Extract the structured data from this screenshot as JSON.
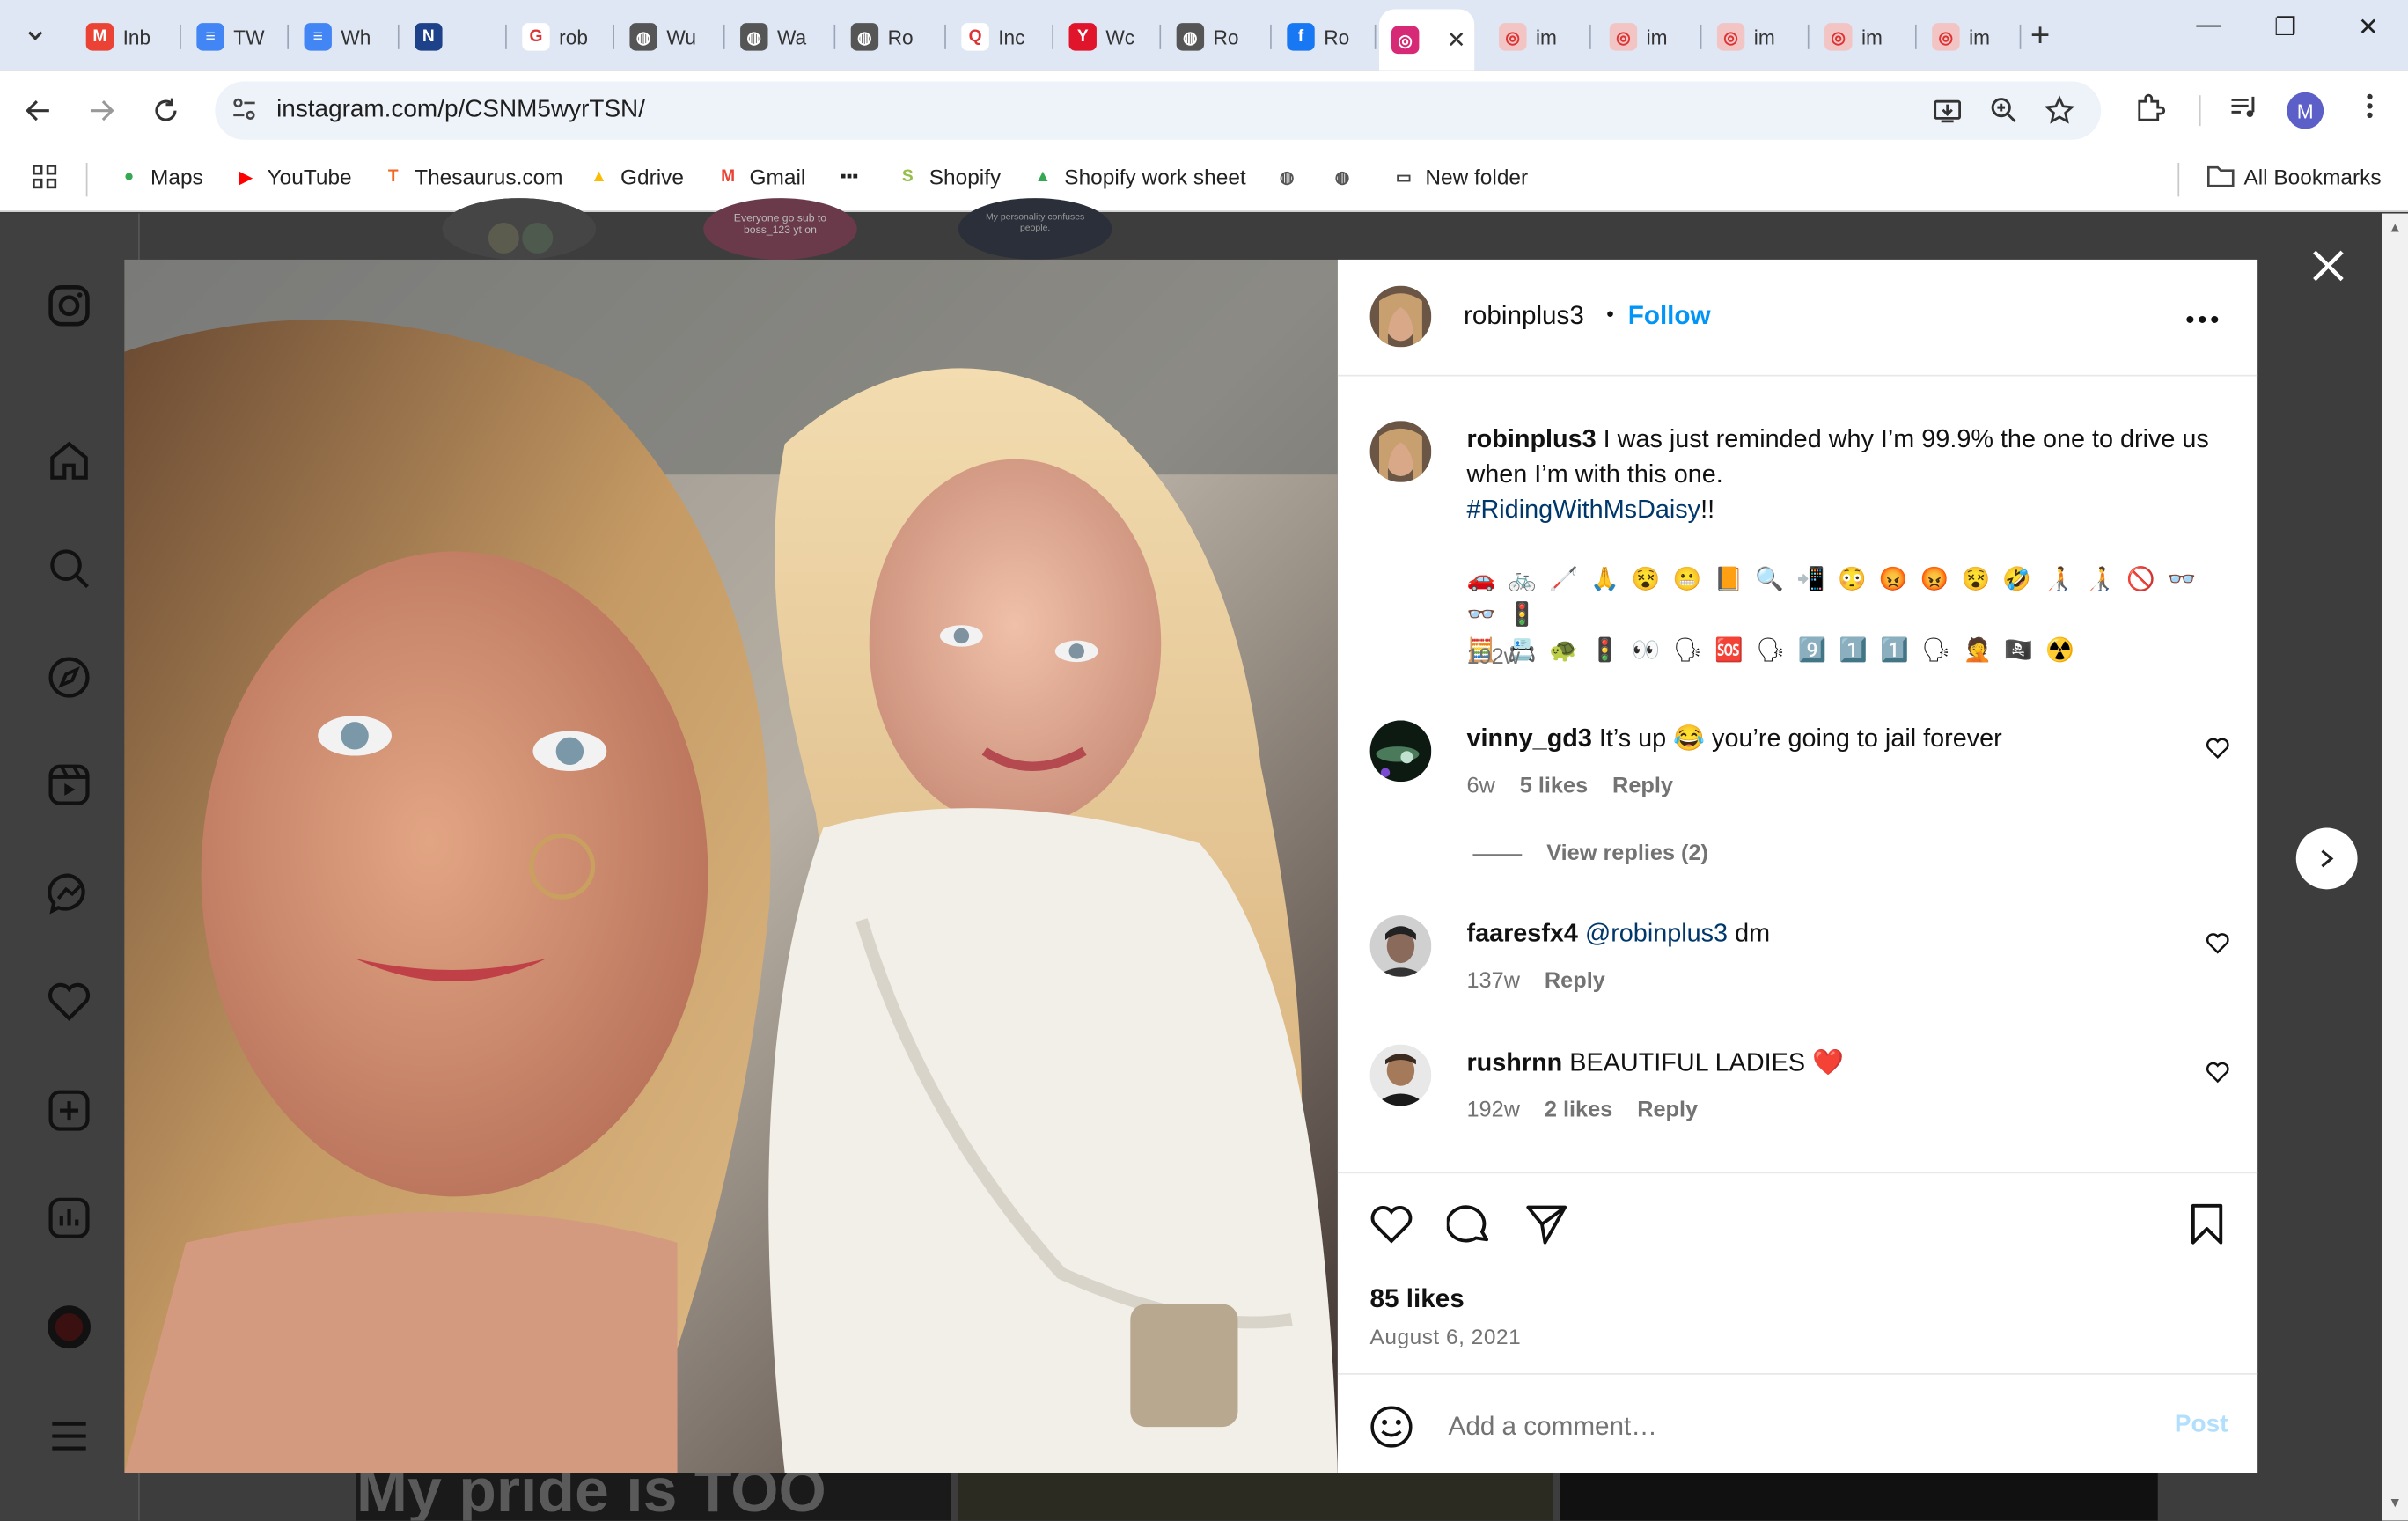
{
  "browser": {
    "tabs": [
      {
        "label": "Inb",
        "fav_color": "#ea4335",
        "fav_text": "M"
      },
      {
        "label": "TW",
        "fav_color": "#4285f4",
        "fav_text": "≡"
      },
      {
        "label": "Wh",
        "fav_color": "#4285f4",
        "fav_text": "≡"
      },
      {
        "label": "",
        "fav_color": "#1d428a",
        "fav_text": "N"
      },
      {
        "label": "rob",
        "fav_color": "#ffffff",
        "fav_text": "G"
      },
      {
        "label": "Wu",
        "fav_color": "#555555",
        "fav_text": "◍"
      },
      {
        "label": "Wa",
        "fav_color": "#555555",
        "fav_text": "◍"
      },
      {
        "label": "Ro",
        "fav_color": "#555555",
        "fav_text": "◍"
      },
      {
        "label": "Inc",
        "fav_color": "#ffffff",
        "fav_text": "Q"
      },
      {
        "label": "Wc",
        "fav_color": "#e0142b",
        "fav_text": "Y"
      },
      {
        "label": "Ro",
        "fav_color": "#555555",
        "fav_text": "◍"
      },
      {
        "label": "Ro",
        "fav_color": "#1877f2",
        "fav_text": "f"
      },
      {
        "label": "",
        "fav_color": "#d62976",
        "fav_text": "◎"
      },
      {
        "label": "im",
        "fav_color": "#f2c4c4",
        "fav_text": "◎"
      },
      {
        "label": "im",
        "fav_color": "#f2c4c4",
        "fav_text": "◎"
      },
      {
        "label": "im",
        "fav_color": "#f2c4c4",
        "fav_text": "◎"
      },
      {
        "label": "im",
        "fav_color": "#f2c4c4",
        "fav_text": "◎"
      },
      {
        "label": "im",
        "fav_color": "#f2c4c4",
        "fav_text": "◎"
      }
    ],
    "url": "instagram.com/p/CSNM5wyrTSN/",
    "profile_initial": "M",
    "bookmarks": [
      {
        "label": "Maps",
        "icon": "maps-icon",
        "color": "#34a853",
        "glyph": "●"
      },
      {
        "label": "YouTube",
        "icon": "youtube-icon",
        "color": "#ff0000",
        "glyph": "▶"
      },
      {
        "label": "Thesaurus.com",
        "icon": "thesaurus-icon",
        "color": "#f26522",
        "glyph": "T"
      },
      {
        "label": "Gdrive",
        "icon": "gdrive-icon",
        "color": "#fbbc04",
        "glyph": "▲"
      },
      {
        "label": "Gmail",
        "icon": "gmail-icon",
        "color": "#ea4335",
        "glyph": "M"
      },
      {
        "label": "",
        "icon": "bbc-icon",
        "color": "#222222",
        "glyph": "▪▪▪"
      },
      {
        "label": "Shopify",
        "icon": "shopify-icon",
        "color": "#95bf47",
        "glyph": "S"
      },
      {
        "label": "Shopify work sheet",
        "icon": "gdrive-icon",
        "color": "#34a853",
        "glyph": "▲"
      },
      {
        "label": "",
        "icon": "globe-icon",
        "color": "#555555",
        "glyph": "◍"
      },
      {
        "label": "",
        "icon": "globe-icon",
        "color": "#555555",
        "glyph": "◍"
      },
      {
        "label": "New folder",
        "icon": "folder-icon",
        "color": "#444444",
        "glyph": "▭"
      }
    ],
    "all_bookmarks": "All Bookmarks"
  },
  "background": {
    "story_text": "Everyone go sub to boss_123 yt on",
    "story_text_2": "My personality confuses people.",
    "post_text": "My pride is TOO"
  },
  "post": {
    "author": "robinplus3",
    "dot": "•",
    "follow_label": "Follow",
    "caption": {
      "user": "robinplus3",
      "text": "I was just reminded why I’m 99.9% the one to drive us when I’m with this one.",
      "hashtag": "#RidingWithMsDaisy",
      "after_hashtag": "!!",
      "emojis_line1": "🚗 🚲 🦯 🙏 😵 😬 📙 🔍 📲 😳 😡 😡 😵 🤣 🧑‍🦯 🧑‍🦯 🚫 👓 👓 🚦",
      "emojis_line2": "🧮 📇 🐢 🚦 👀 🗣 🆘 🗣 9️⃣ 1️⃣ 1️⃣ 🗣 🤦 🏴‍☠️ ☢️",
      "time": "192w"
    },
    "comments": [
      {
        "user": "vinny_gd3",
        "text": "It’s up 😂 you’re going to jail forever",
        "time": "6w",
        "likes": "5 likes",
        "reply": "Reply"
      },
      {
        "user": "faaresfx4",
        "mention": "@robinplus3",
        "text": "dm",
        "time": "137w",
        "reply": "Reply"
      },
      {
        "user": "rushrnn",
        "text": "BEAUTIFUL LADIES ❤️",
        "time": "192w",
        "likes": "2 likes",
        "reply": "Reply"
      }
    ],
    "view_replies": "View replies (2)",
    "likes": "85 likes",
    "date": "August 6, 2021",
    "add_comment_placeholder": "Add a comment…",
    "post_button": "Post"
  }
}
